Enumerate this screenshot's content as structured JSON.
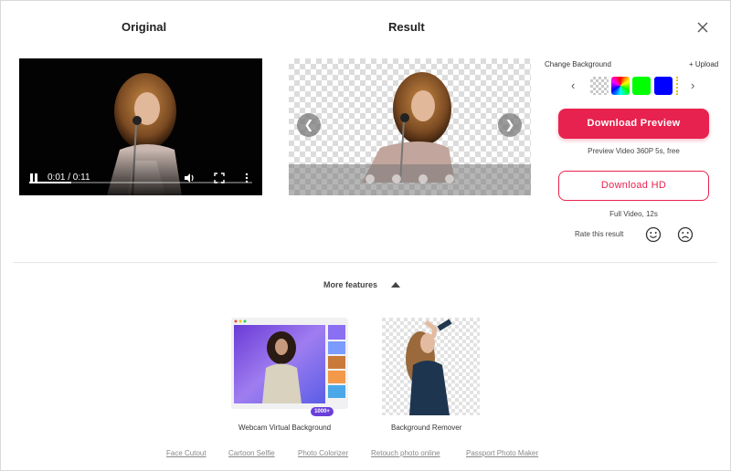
{
  "header": {
    "original_title": "Original",
    "result_title": "Result",
    "close_icon": "close-icon"
  },
  "video": {
    "time": "0:01 / 0:11",
    "progress": 0.19,
    "icons": [
      "pause-icon",
      "volume-icon",
      "fullscreen-icon",
      "more-icon"
    ]
  },
  "result_preview": {
    "prev_icon": "chevron-left-icon",
    "next_icon": "chevron-right-icon",
    "slides": 4
  },
  "background_panel": {
    "label": "Change Background",
    "upload": "+ Upload",
    "swatches": [
      {
        "name": "transparent",
        "color": "transparent"
      },
      {
        "name": "rainbow",
        "color": "multicolor"
      },
      {
        "name": "green",
        "color": "#00ff00"
      },
      {
        "name": "blue",
        "color": "#0000ff"
      }
    ]
  },
  "download": {
    "preview_label": "Download Preview",
    "preview_note": "Preview Video 360P 5s, free",
    "hd_label": "Download HD",
    "hd_note": "Full Video, 12s"
  },
  "rating": {
    "label": "Rate this result"
  },
  "more_features": {
    "label": "More features",
    "cards": [
      {
        "label": "Webcam Virtual Background",
        "badge": "1000+"
      },
      {
        "label": "Background Remover"
      }
    ],
    "links": [
      "Face Cutout",
      "Cartoon Selfie",
      "Photo Colorizer",
      "Retouch photo online",
      "Passport Photo Maker"
    ]
  },
  "colors": {
    "accent": "#e8224e",
    "badge": "#6a3fd9"
  }
}
